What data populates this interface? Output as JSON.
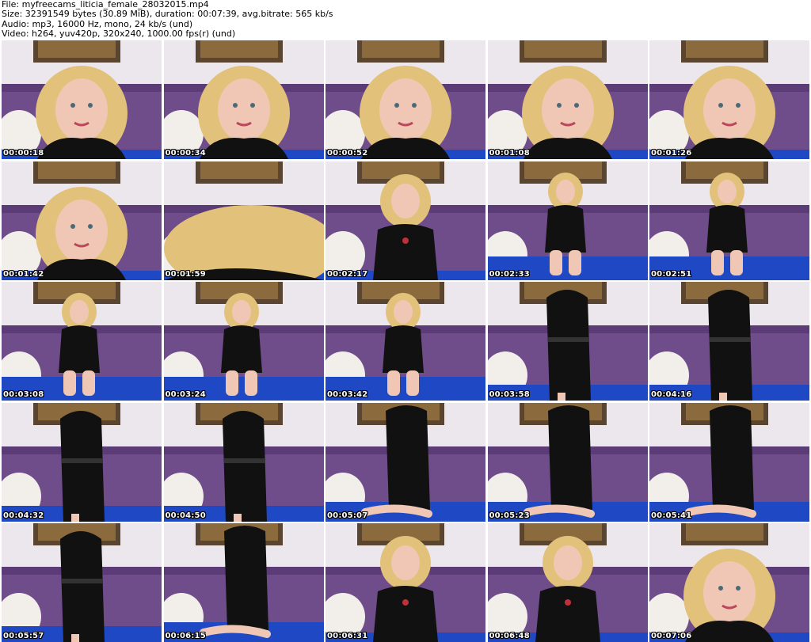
{
  "header": {
    "file": "File: myfreecams_liticia_female_28032015.mp4",
    "size": "Size: 32391549 bytes (30.89 MiB), duration: 00:07:39, avg.bitrate: 565 kb/s",
    "audio": "Audio: mp3, 16000 Hz, mono, 24 kb/s (und)",
    "video": "Video: h264, yuv420p, 320x240, 1000.00 fps(r) (und)"
  },
  "colors": {
    "wall": "#ece7ec",
    "sofa": "#6f4d8a",
    "blanket": "#1f49c4",
    "pillow": "#f2efea",
    "dress": "#111111",
    "hair": "#e2c27a",
    "skin": "#f0c7b4",
    "frame": "#5a4630"
  },
  "thumbnails": [
    {
      "timestamp": "00:00:18",
      "shot": "close"
    },
    {
      "timestamp": "00:00:34",
      "shot": "close"
    },
    {
      "timestamp": "00:00:52",
      "shot": "close"
    },
    {
      "timestamp": "00:01:08",
      "shot": "close"
    },
    {
      "timestamp": "00:01:26",
      "shot": "close"
    },
    {
      "timestamp": "00:01:42",
      "shot": "close"
    },
    {
      "timestamp": "00:01:59",
      "shot": "hair"
    },
    {
      "timestamp": "00:02:17",
      "shot": "mid"
    },
    {
      "timestamp": "00:02:33",
      "shot": "seated"
    },
    {
      "timestamp": "00:02:51",
      "shot": "seated"
    },
    {
      "timestamp": "00:03:08",
      "shot": "seated"
    },
    {
      "timestamp": "00:03:24",
      "shot": "seated"
    },
    {
      "timestamp": "00:03:42",
      "shot": "seated"
    },
    {
      "timestamp": "00:03:58",
      "shot": "standing"
    },
    {
      "timestamp": "00:04:16",
      "shot": "standing"
    },
    {
      "timestamp": "00:04:32",
      "shot": "standing"
    },
    {
      "timestamp": "00:04:50",
      "shot": "standing"
    },
    {
      "timestamp": "00:05:07",
      "shot": "kneeling"
    },
    {
      "timestamp": "00:05:23",
      "shot": "kneeling"
    },
    {
      "timestamp": "00:05:41",
      "shot": "kneeling"
    },
    {
      "timestamp": "00:05:57",
      "shot": "standing"
    },
    {
      "timestamp": "00:06:15",
      "shot": "kneeling"
    },
    {
      "timestamp": "00:06:31",
      "shot": "mid"
    },
    {
      "timestamp": "00:06:48",
      "shot": "mid"
    },
    {
      "timestamp": "00:07:06",
      "shot": "close"
    }
  ]
}
